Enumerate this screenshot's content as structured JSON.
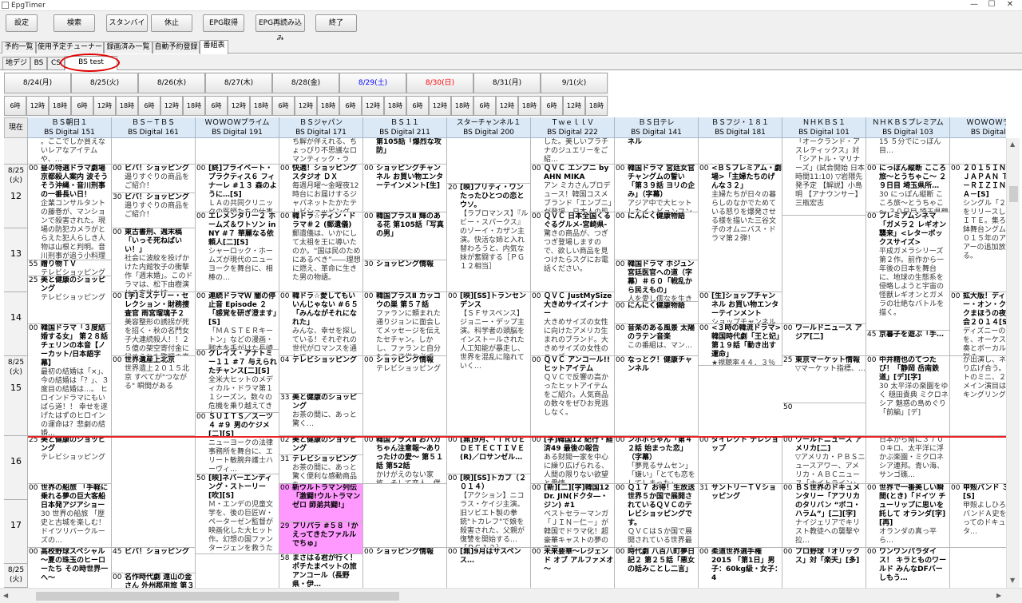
{
  "window": {
    "title": "EpgTimer",
    "minimize": "—",
    "maximize": "☐",
    "close": "✕"
  },
  "toolbar": {
    "buttons": [
      "設定",
      "検索",
      "スタンバイ",
      "休止",
      "EPG取得",
      "EPG再読み込み",
      "終了"
    ]
  },
  "main_tabs": [
    "予約一覧",
    "使用予定チューナー",
    "録画済み一覧",
    "自動予約登録",
    "番組表"
  ],
  "sub_tabs": [
    "地デジ",
    "BS",
    "CS",
    "BS test"
  ],
  "dates": [
    {
      "label": "8/24(月)",
      "color": "#000000"
    },
    {
      "label": "8/25(火)",
      "color": "#000000"
    },
    {
      "label": "8/26(水)",
      "color": "#000000"
    },
    {
      "label": "8/27(木)",
      "color": "#000000"
    },
    {
      "label": "8/28(金)",
      "color": "#000000"
    },
    {
      "label": "8/29(土)",
      "color": "#0000ff"
    },
    {
      "label": "8/30(日)",
      "color": "#ff0000"
    },
    {
      "label": "8/31(月)",
      "color": "#000000"
    },
    {
      "label": "9/1(火)",
      "color": "#000000"
    }
  ],
  "hour_labels": [
    "6時",
    "12時",
    "18時"
  ],
  "corner_label": "現在",
  "channels": [
    {
      "name": "ＢＳ朝日１",
      "sub": "BS Digital 151"
    },
    {
      "name": "ＢＳ－ＴＢＳ",
      "sub": "BS Digital 161"
    },
    {
      "name": "ＷＯＷＯＷプライム",
      "sub": "BS Digital 191"
    },
    {
      "name": "ＢＳジャパン",
      "sub": "BS Digital 171"
    },
    {
      "name": "ＢＳ１１",
      "sub": "BS Digital 211"
    },
    {
      "name": "スターチャンネル１",
      "sub": "BS Digital 200"
    },
    {
      "name": "ＴｗｅｌｌＶ",
      "sub": "BS Digital 222"
    },
    {
      "name": "ＢＳ日テレ",
      "sub": "BS Digital 141"
    },
    {
      "name": "ＢＳフジ・１８１",
      "sub": "BS Digital 181"
    },
    {
      "name": "ＮＨＫＢＳ１",
      "sub": "BS Digital 101"
    },
    {
      "name": "ＮＨＫＢＳプレミアム",
      "sub": "BS Digital 103"
    },
    {
      "name": "ＷＯＷＯＷライ",
      "sub": "BS Digital 1"
    }
  ],
  "time_rows": [
    {
      "date": "",
      "hour": ""
    },
    {
      "date": "8/25 (火)",
      "hour": "12"
    },
    {
      "date": "",
      "hour": "13"
    },
    {
      "date": "",
      "hour": "14"
    },
    {
      "date": "8/25 (火)",
      "hour": "15"
    },
    {
      "date": "",
      "hour": "16"
    },
    {
      "date": "",
      "hour": "17"
    },
    {
      "date": "8/25 (火)",
      "hour": ""
    }
  ],
  "programs": [
    {
      "ch": 0,
      "r": 0,
      "s": 0,
      "e": 0.4,
      "m": "",
      "t": "",
      "d": "。ここでしか買えないレアなアイテムや、…"
    },
    {
      "ch": 0,
      "r": 0,
      "s": 0.4,
      "e": 1.9,
      "m": "00",
      "t": "昼の特選ドラマ劇場 京都殺人案内 波そう そう沖縄・音川刑事の一番長い日！",
      "d": "企業コンサルタントの藤巻が、マンションで殺害された。現場の防犯カメラがとらえた犯人らしき人物は山根と判明。音川刑事が追う小料理屋の女将・早苗の元事主だった… 出演者 藤田まこと、萬田久…"
    },
    {
      "ch": 0,
      "r": 0,
      "s": 1.9,
      "e": 2.15,
      "m": "55",
      "t": "贈り物ＴＶ",
      "d": "テレビショッピング"
    },
    {
      "ch": 0,
      "r": 0,
      "s": 2.15,
      "e": 2.9,
      "m": "25",
      "t": "美と健康のショッピング",
      "d": "テレビショッピング"
    },
    {
      "ch": 0,
      "r": 0,
      "s": 2.9,
      "e": 4.25,
      "m": "00",
      "t": "韓国ドラマ「３度結婚する女」 第２８話 チェリンの本音【ノーカット/日本語字幕】",
      "d": "最初の結婚は「×」、今の結婚は「？」、３度目の結婚は…。 ヒロインドラマにもいばら道！！ 幸せを遂げたはずのヒロインの運命は？悲劇の結婚…"
    },
    {
      "ch": 0,
      "r": 0,
      "s": 4.25,
      "e": 5.0,
      "m": "25",
      "t": "美と健康のショッピング",
      "d": "テレビショッピング"
    },
    {
      "ch": 0,
      "r": 0,
      "s": 5.0,
      "e": 6.0,
      "m": "00",
      "t": "世界の船旅 「手軽に乗れる夢の巨大客船日本発アジアショー",
      "d": "30 世界の船旅 「歴史と古城を楽しむ！ドイツリバークルーズの…"
    },
    {
      "ch": 0,
      "r": 0,
      "s": 6.0,
      "e": 7.0,
      "m": "00",
      "t": "高校野球スペシャル～夏の珠玉のヒーローたち その時世界一へ～",
      "d": ""
    },
    {
      "ch": 1,
      "r": 0,
      "s": 0,
      "e": 0.4,
      "m": "",
      "t": "",
      "d": ""
    },
    {
      "ch": 1,
      "r": 0,
      "s": 0.4,
      "e": 0.85,
      "m": "00",
      "t": "ビバ！ショッピング",
      "d": "邉りすぐりの商品をご紹介！"
    },
    {
      "ch": 1,
      "r": 0,
      "s": 0.85,
      "e": 1.4,
      "m": "30",
      "t": "ビバ！ショッピング",
      "d": "邉りすぐりの商品をご紹介！"
    },
    {
      "ch": 1,
      "r": 0,
      "s": 1.4,
      "e": 2.4,
      "m": "00",
      "t": "東古書刑、週末稿「いっそ死ねばいい！」",
      "d": "社会に波紋を投げかけた内館牧子の衝撃作「週末婚」。このドラマは、松下由樹演じる奔放な姉…"
    },
    {
      "ch": 1,
      "r": 0,
      "s": 2.4,
      "e": 3.4,
      "m": "00",
      "t": "[字]ミステリー・セレクション・財務捜査官 雨宮瑠璃子２",
      "d": "美容整形の誘拐が死を招く・秋の名門女子大連続殺人！！２５億の架空寄付金に秘められた驚愕の真実とは？！"
    },
    {
      "ch": 1,
      "r": 0,
      "s": 3.4,
      "e": 4.25,
      "m": "00",
      "t": "世界遺産上北京",
      "d": "世界遺上２０１５北京 すべてが\"つながる\" 瞬間がある"
    },
    {
      "ch": 1,
      "r": 0,
      "s": 4.25,
      "e": 6.0,
      "m": "",
      "t": "",
      "d": ""
    },
    {
      "ch": 1,
      "r": 0,
      "s": 6.0,
      "e": 6.4,
      "m": "45",
      "t": "ビバ！ショッピング",
      "d": ""
    },
    {
      "ch": 1,
      "r": 0,
      "s": 6.4,
      "e": 7.0,
      "m": "00",
      "t": "名作時代劇 遠山の金さん 外州郡用旅 第３部「呪いの鈴剣・盟山の",
      "d": ""
    },
    {
      "ch": 2,
      "r": 0,
      "s": 0,
      "e": 0.4,
      "m": "",
      "t": "",
      "d": ""
    },
    {
      "ch": 2,
      "r": 0,
      "s": 0.4,
      "e": 1.15,
      "m": "00",
      "t": "[終]プライベート・プラクティス６ フィナーレ #１３ 森のように…[S]",
      "d": "ＬＡの共同クリニックの医師たちの仕事と…"
    },
    {
      "ch": 2,
      "r": 0,
      "s": 1.15,
      "e": 2.4,
      "m": "00",
      "t": "エレメンタリー２ ホームズ＆ワトソン in NY #７ 華麗なる依頼人[二][S]",
      "d": "シャーロック・ホームズが現代のニューヨークを舞台に、相棒の…"
    },
    {
      "ch": 2,
      "r": 0,
      "s": 2.4,
      "e": 3.3,
      "m": "00",
      "t": "連続ドラマＷ 闇の停止音 Episode ２「感覚を研ぎ澄ます」[S]",
      "d": "「ＭＡＳＴＥＲキートン」などの漫画・脚本を手がけた長崎尚志…"
    },
    {
      "ch": 2,
      "r": 0,
      "s": 3.3,
      "e": 4.0,
      "m": "00",
      "t": "グレイズ・アナトミー１１ #７ 与えられたチャンス[二][S]",
      "d": "全米大ヒットのメディカル・ドラマ第１１シーズン。数々の危機を乗り越えてきた…"
    },
    {
      "ch": 2,
      "r": 0,
      "s": 4.0,
      "e": 4.85,
      "m": "00",
      "t": "ＳＵＩＴＳ／スーツ４ #９ 男のケジメ[二][S]",
      "d": "ニューヨークの法律事務所を舞台に、エリート敏腕弁護士ハーヴィ…"
    },
    {
      "ch": 2,
      "r": 0,
      "s": 4.85,
      "e": 6.1,
      "m": "50",
      "t": "[映]ネバーエンディング・ストーリー[吹][S]",
      "d": "Ｍ・エンデの児童文学を、後の巨匠Ｗ・ペーターゼン監督が映画化した大ヒット作。幻想の国ファンタージェンを救うため…"
    },
    {
      "ch": 2,
      "r": 0,
      "s": 6.1,
      "e": 7.0,
      "m": "",
      "t": "",
      "d": ""
    },
    {
      "ch": 3,
      "r": 0,
      "s": 0,
      "e": 0.4,
      "m": "",
      "t": "",
      "d": "ち解が伴えれる、ちょっぴり不思議なロマンティック・ラブ…"
    },
    {
      "ch": 3,
      "r": 0,
      "s": 0.4,
      "e": 1.15,
      "m": "00",
      "t": "快適！ショッピングスタジオ ＤＸ",
      "d": "毎週月曜～金曜夜12時台にお届けするジャパネットたかたテレビショッピング。人気の家電製品やワクワク…"
    },
    {
      "ch": 3,
      "r": 0,
      "s": 1.15,
      "e": 2.4,
      "m": "00",
      "t": "韓ドラ☆ティン・ドラマ＃２ (郵遺儀)",
      "d": "郵遺儀は、いかにして太祖を王に導いたのか。“国は民のためにあるべき”――理想に燃え、革命に生きた男の物語。"
    },
    {
      "ch": 3,
      "r": 0,
      "s": 2.4,
      "e": 3.4,
      "m": "00",
      "t": "韓ドラ☆愛してもいいんじゃない #６５「みんながそれになれた」",
      "d": "みんな、幸せを探している！それぞれの世代がロマンスを通して…"
    },
    {
      "ch": 3,
      "r": 0,
      "s": 3.4,
      "e": 3.8,
      "m": "04",
      "t": "テレビショッピング",
      "d": ""
    },
    {
      "ch": 3,
      "r": 0,
      "s": 3.8,
      "e": 4.25,
      "m": "33",
      "t": "美と健康のショッピング",
      "d": "お茶の間に、あっと驚く…"
    },
    {
      "ch": 3,
      "r": 0,
      "s": 4.25,
      "e": 4.55,
      "m": "02",
      "t": "美と健康のショッピング",
      "d": ""
    },
    {
      "ch": 3,
      "r": 0,
      "s": 4.55,
      "e": 5.0,
      "m": "31",
      "t": "テレビショッピング",
      "d": "お茶の間に、あっと驚く便利な感動商品を…"
    },
    {
      "ch": 3,
      "r": 0,
      "s": 5.0,
      "e": 5.6,
      "m": "00",
      "t": "新ウルトラマン列伝「激闘!ウルトラマンゼロ 師弟共闘!」",
      "d": "",
      "pink": true
    },
    {
      "ch": 3,
      "r": 0,
      "s": 5.6,
      "e": 6.1,
      "m": "29",
      "t": "プリパラ #５８「かえってきたファルルでちゅ」",
      "d": "",
      "pink": true
    },
    {
      "ch": 3,
      "r": 0,
      "s": 6.1,
      "e": 7.0,
      "m": "58",
      "t": "まさはる君が行く！ポチたまペットの旅 アンコール（長野県・伊…",
      "d": ""
    },
    {
      "ch": 4,
      "r": 0,
      "s": 0,
      "e": 0.4,
      "m": "",
      "t": "第105話「爆烈な攻防」",
      "d": ""
    },
    {
      "ch": 4,
      "r": 0,
      "s": 0.4,
      "e": 1.15,
      "m": "00",
      "t": "ショッピングチャンネル お買い物エンターテインメント[生]",
      "d": ""
    },
    {
      "ch": 4,
      "r": 0,
      "s": 1.15,
      "e": 1.9,
      "m": "00",
      "t": "韓国プラスⅡ 輝のある花 第105話「写真の男」",
      "d": ""
    },
    {
      "ch": 4,
      "r": 0,
      "s": 1.9,
      "e": 2.4,
      "m": "30",
      "t": "ショッピング情報",
      "d": ""
    },
    {
      "ch": 4,
      "r": 0,
      "s": 2.4,
      "e": 3.4,
      "m": "00",
      "t": "韓国プラスⅡ カッコウの巣 第５７話",
      "d": "ファランに頼まれた通りジョンに面会してメッセージを伝えたセチャン。しかし、ファランと自分たちの子供を必ず…"
    },
    {
      "ch": 4,
      "r": 0,
      "s": 3.4,
      "e": 4.25,
      "m": "00",
      "t": "ショッピング情報",
      "d": "テレビショッピング"
    },
    {
      "ch": 4,
      "r": 0,
      "s": 4.25,
      "e": 5.0,
      "m": "00",
      "t": "韓国プラスⅡ おバカちゃん注意報～ありったけの愛～ 第５１話 第52話",
      "d": "かけがえのない家族、そして恋人。僕の家族を捧げる。イム・シフ…"
    },
    {
      "ch": 4,
      "r": 0,
      "s": 5.0,
      "e": 6.0,
      "m": "",
      "t": "",
      "d": ""
    },
    {
      "ch": 4,
      "r": 0,
      "s": 6.0,
      "e": 7.0,
      "m": "00",
      "t": "ショッピング情報",
      "d": ""
    },
    {
      "ch": 5,
      "r": 0,
      "s": 0,
      "e": 0.7,
      "m": "",
      "t": "",
      "d": ""
    },
    {
      "ch": 5,
      "r": 0,
      "s": 0.7,
      "e": 2.4,
      "m": "20",
      "t": "[映]プリティ・ワンたったひとつの恋とウソ。",
      "d": "【ラブロマンス】『ルビー・スパークス』のゾーイ・カザン主演。快活な姉と入れ替わろうと、内気な妹が奮闘する［ＰＧ１２相当］"
    },
    {
      "ch": 5,
      "r": 0,
      "s": 2.4,
      "e": 4.25,
      "m": "00",
      "t": "[映][SS]トランセンデンス",
      "d": "【ＳＦサスペンス】ジョニー・デップ主演。科学者の頭脳をインストールされた人工知能が暴走し、世界を混乱に陥れていく…"
    },
    {
      "ch": 5,
      "r": 0,
      "s": 4.25,
      "e": 4.85,
      "m": "00",
      "t": "[無]9月、「ＴＲＵＥ ＤＥＴＥＣＴＩＶＥ(R)／ロサンゼル…",
      "d": ""
    },
    {
      "ch": 5,
      "r": 0,
      "s": 4.85,
      "e": 6.0,
      "m": "00",
      "t": "[映][SS]トカブ（２０１４）",
      "d": "【アクション】ニコラス・ケイジ主演。旧ソビエト製の拳銃\"トカレフ\"で娘を殺害された、父親が復讐を開始する…［ＰＧ１２］"
    },
    {
      "ch": 5,
      "r": 0,
      "s": 6.0,
      "e": 7.0,
      "m": "00",
      "t": "[無]9月はサスペンス…",
      "d": ""
    },
    {
      "ch": 6,
      "r": 0,
      "s": 0,
      "e": 0.4,
      "m": "",
      "t": "",
      "d": "した。美しいプラチナのジュエリーをご紹…"
    },
    {
      "ch": 6,
      "r": 0,
      "s": 0.4,
      "e": 1.15,
      "m": "00",
      "t": "ＱＶＣ エンプニ by AHN MIKA",
      "d": "アン ミカさんプロデュース！韓国コスメブランド「エンプニ」が登場。日本人の肌色と肌質に合うようこ…"
    },
    {
      "ch": 6,
      "r": 0,
      "s": 1.15,
      "e": 2.4,
      "m": "00",
      "t": "ＱＶＣ 日本全国くるぐるグルメ-宮崎県-",
      "d": "驚きの商品が、つぎつぎ登場しますので、欲しい商品を見つけたらスグにお電話ください。"
    },
    {
      "ch": 6,
      "r": 0,
      "s": 2.4,
      "e": 3.4,
      "m": "00",
      "t": "ＱＶＣ JustMySize 大きめサイズインナー",
      "d": "大きめサイズの女性に向けたアメリカ生まれのブランド。大きめサイズの女性のニーズ…"
    },
    {
      "ch": 6,
      "r": 0,
      "s": 3.4,
      "e": 4.25,
      "m": "00",
      "t": "ＱＶＣ アンコール!! ヒットアイテム",
      "d": "ＱＶＣで反響の高かったヒットアイテムをご紹介。人気商品の数々をぜひお見逃しなく。"
    },
    {
      "ch": 6,
      "r": 0,
      "s": 4.25,
      "e": 5.0,
      "m": "00",
      "t": "[字]韓国12 紀行・経済49 最後の報告",
      "d": "ある財閥一家を中心に繰り広げられる、人間の限りない欲望と愛情…"
    },
    {
      "ch": 6,
      "r": 0,
      "s": 5.0,
      "e": 6.0,
      "m": "00",
      "t": "[新][二][字]韓国12 Dr. JIN(ドクタ―・ジン) #1",
      "d": "ベストセラーマンガ「ＪＩＮ－仁－」が韓国でドラマ化！超豪華キャストの夢の競演…"
    },
    {
      "ch": 6,
      "r": 0,
      "s": 6.0,
      "e": 7.0,
      "m": "00",
      "t": "未来要華～レジェンド オブ アルファメオ～",
      "d": ""
    },
    {
      "ch": 7,
      "r": 0,
      "s": 0,
      "e": 0.4,
      "m": "",
      "t": "ネル",
      "d": ""
    },
    {
      "ch": 7,
      "r": 0,
      "s": 0.4,
      "e": 1.15,
      "m": "00",
      "t": "韓国ドラマ 宮廷女官チャングムの誓い「第３９話 ヨリの企み」（字幕）",
      "d": "アジア中で大ヒットしたイ・ビョンフン監督の超人気歴史ドラマ…"
    },
    {
      "ch": 7,
      "r": 0,
      "s": 1.15,
      "e": 1.9,
      "m": "00",
      "t": "にんにく健康物語",
      "d": ""
    },
    {
      "ch": 7,
      "r": 0,
      "s": 1.9,
      "e": 2.55,
      "m": "00",
      "t": "韓国ドラマ ホジュン 宮廷医官への道（字幕）＃６０「戦乱から民えもの」",
      "d": "人を愛し儒なを生きた男。ホジュン。天運を信じ、その生を乗り越え…"
    },
    {
      "ch": 7,
      "r": 0,
      "s": 2.55,
      "e": 2.9,
      "m": "00",
      "t": "にんにく健康物語",
      "d": ""
    },
    {
      "ch": 7,
      "r": 0,
      "s": 2.9,
      "e": 3.4,
      "m": "00",
      "t": "音楽のある風景 太陽のラテン音楽",
      "d": "この番組は、マン…"
    },
    {
      "ch": 7,
      "r": 0,
      "s": 3.4,
      "e": 4.25,
      "m": "00",
      "t": "なっとク！健康チャンネル",
      "d": ""
    },
    {
      "ch": 7,
      "r": 0,
      "s": 4.25,
      "e": 5.0,
      "m": "00",
      "t": "ンボボちゃん「第４２話 始まった恋」（字幕）",
      "d": "「夢見るサムセン」「嫌い」「とても恋をしてしまった」"
    },
    {
      "ch": 7,
      "r": 0,
      "s": 5.0,
      "e": 6.0,
      "m": "00",
      "t": "Ｑ１７ お得！生放送 世界５か国で展開されているＱＶＣのテレビショッピングです。",
      "d": "ＱＶＣはＳか国で展開されている世界最大…"
    },
    {
      "ch": 7,
      "r": 0,
      "s": 6.0,
      "e": 7.0,
      "m": "00",
      "t": "時代劇 八百八町夢日記２ 第２５話「悪女の話みことし二言」",
      "d": ""
    },
    {
      "ch": 8,
      "r": 0,
      "s": 0,
      "e": 0.4,
      "m": "",
      "t": "",
      "d": ""
    },
    {
      "ch": 8,
      "r": 0,
      "s": 0.4,
      "e": 2.4,
      "m": "00",
      "t": "<ＢＳプレミアム・劇場>「主婦たちのげんな３２」",
      "d": "主婦たちが日々の暮らしのなかでためている怒りを爆発させる様を描いた三谷文子のオムニバス・ドラマ第２弾！"
    },
    {
      "ch": 8,
      "r": 0,
      "s": 2.4,
      "e": 2.9,
      "m": "00",
      "t": "[生]ショップチャンネル お買い物エンターテインメント",
      "d": "ショップチャンネルは、国内外から買付けた商品を生放送でご紹介。ここでしか買えな…"
    },
    {
      "ch": 8,
      "r": 0,
      "s": 2.9,
      "e": 3.5,
      "m": "00",
      "t": "<３時の韓流ドラマ>韓国時代劇「王と妃」第１９話「動き出す運命」",
      "d": "★視聴率４４．３％獲得！確論ワンガの悲劇の生涯を描いた…"
    },
    {
      "ch": 8,
      "r": 0,
      "s": 4.25,
      "e": 5.0,
      "m": "00",
      "t": "ダイレクト テレショップ",
      "d": ""
    },
    {
      "ch": 8,
      "r": 0,
      "s": 5.0,
      "e": 6.0,
      "m": "31",
      "t": "サントリーＴＶショッピング",
      "d": ""
    },
    {
      "ch": 8,
      "r": 0,
      "s": 6.0,
      "e": 7.0,
      "m": "00",
      "t": "柔道世界選手権2015 「第1日」男子：60kg級・女子：4",
      "d": ""
    },
    {
      "ch": 9,
      "r": 0,
      "s": 0,
      "e": 1.2,
      "m": "",
      "t": "",
      "d": "「オークランド・アスレティックス」対「シアトル・マリナーズ」(試合開始 日本時間11:10) ▽岩隈先発予定 【解説】小島明 【アナウンサー】三瓶宏志"
    },
    {
      "ch": 9,
      "r": 0,
      "s": 1.2,
      "e": 2.9,
      "m": "",
      "t": "",
      "d": ""
    },
    {
      "ch": 9,
      "r": 0,
      "s": 2.9,
      "e": 3.4,
      "m": "00",
      "t": "ワールドニュース アジア[二]",
      "d": ""
    },
    {
      "ch": 9,
      "r": 0,
      "s": 3.4,
      "e": 3.9,
      "m": "25",
      "t": "東京マーケット情報",
      "d": "▽マーケット指標、…"
    },
    {
      "ch": 9,
      "r": 0,
      "s": 3.9,
      "e": 4.25,
      "m": "50",
      "t": "",
      "d": ""
    },
    {
      "ch": 9,
      "r": 0,
      "s": 4.25,
      "e": 5.0,
      "m": "00",
      "t": "ワールドニュース アメリカ[二]",
      "d": "▽アメリカ・ＰＢＳニュースアワー、アメリカ・ＡＢＣニュース「ナイトライン」"
    },
    {
      "ch": 9,
      "r": 0,
      "s": 5.0,
      "e": 6.0,
      "m": "00",
      "t": "ＢＳ世界のドキュメンタリー「アフリカのタリバン “ボコ・ハラム”」[二][字]",
      "d": "ナイジェリアでキリスト教徒への襲撃や拉…"
    },
    {
      "ch": 9,
      "r": 0,
      "s": 6.0,
      "e": 7.0,
      "m": "00",
      "t": "プロ野球「オリックス」対「楽天」[多]",
      "d": ""
    },
    {
      "ch": 10,
      "r": 0,
      "s": 0,
      "e": 0.4,
      "m": "",
      "t": "",
      "d": "15 ５分でにっぽん目…"
    },
    {
      "ch": 10,
      "r": 0,
      "s": 0.4,
      "e": 1.15,
      "m": "00",
      "t": "にっぽん縦断 こころ旅～とうちゃこ～ ２９日目 埼玉県所…",
      "d": "30 にっぽん縦断 こころ旅～とうちゃこ～ ３０日目 埼玉県鶴ヶ島市[デ][再]"
    },
    {
      "ch": 10,
      "r": 0,
      "s": 1.15,
      "e": 3.0,
      "m": "00",
      "t": "プレミアムシネマ「ガメラ２ レギオン襲来」<レターボックスサイズ>",
      "d": "平成ガメラシリーズ第２作。前作から一年後の日本を舞台に、地球の生態系を侵略しようと宇宙の怪獣レギオンとガメラの壮絶なバトルを描く。"
    },
    {
      "ch": 10,
      "r": 0,
      "s": 3.0,
      "e": 3.4,
      "m": "45",
      "t": "京暮子を遊ぶ「手…",
      "d": ""
    },
    {
      "ch": 10,
      "r": 0,
      "s": 3.4,
      "e": 4.25,
      "m": "00",
      "t": "中井精也のてつたび！「静岡 岳南鉄道」[デ][字]",
      "d": "30 太平洋の楽園をゆく 穏田貴典 ミクロネシア 魅惑の島めぐり「前編」[デ]"
    },
    {
      "ch": 10,
      "r": 0,
      "s": 4.25,
      "e": 5.0,
      "m": "",
      "t": "",
      "d": "日本から南に３７００キロ、太平洋に浮かぶ楽園・ミクロネシア連邦。青い海、サンゴ礁…"
    },
    {
      "ch": 10,
      "r": 0,
      "s": 5.0,
      "e": 6.0,
      "m": "00",
      "t": "世界で一番美しい瞬間(とき)「ドイツ チューリップに思いを託して オランダ[字][再]",
      "d": "オランダの真っ平ら…"
    },
    {
      "ch": 10,
      "r": 0,
      "s": 6.0,
      "e": 7.0,
      "m": "00",
      "t": "ワンワンパラダイス！ キラとものワールド みんなDFバーしもう…",
      "d": ""
    },
    {
      "ch": 11,
      "r": 0,
      "s": 0,
      "e": 0.4,
      "m": "",
      "t": "",
      "d": ""
    },
    {
      "ch": 11,
      "r": 0,
      "s": 0.4,
      "e": 2.4,
      "m": "00",
      "t": "２０１５ＩＮＩＴＥ ＪＡＰＡＮ ＴＯＵＲ －ＲＩＺＩＮ－ＭＭＡ－[S]",
      "d": "シングル「２０１５」をリリースしたＩＮＩＴＥ。集ろうた\"刀鉢舞台ングム\"で約２０１５年のアジアツアーの追加放送する。"
    },
    {
      "ch": 11,
      "r": 0,
      "s": 2.4,
      "e": 3.4,
      "m": "00",
      "t": "拡大版！ディズニー・オン・クラシックまほうの夜の音楽会２０１４[S]",
      "d": "ディズニーの名曲を、オーケストラ演奏とボーカル歌唱で贈る…"
    },
    {
      "ch": 11,
      "r": 0,
      "s": 3.4,
      "e": 4.25,
      "m": "",
      "t": "",
      "d": "が出演し、ネタを繰り広げ合う。サポートのミニ、２０１５メイン演目はキン・キングリング"
    },
    {
      "ch": 11,
      "r": 0,
      "s": 4.25,
      "e": 5.0,
      "m": "",
      "t": "",
      "d": ""
    },
    {
      "ch": 11,
      "r": 0,
      "s": 5.0,
      "e": 6.0,
      "m": "00",
      "t": "甲殻バンド ３[二][S]",
      "d": "甲殻よしひろ自身のバンドＡ史を振り返ってのドキュメンタ…"
    },
    {
      "ch": 11,
      "r": 0,
      "s": 6.0,
      "e": 7.0,
      "m": "",
      "t": "",
      "d": ""
    }
  ]
}
